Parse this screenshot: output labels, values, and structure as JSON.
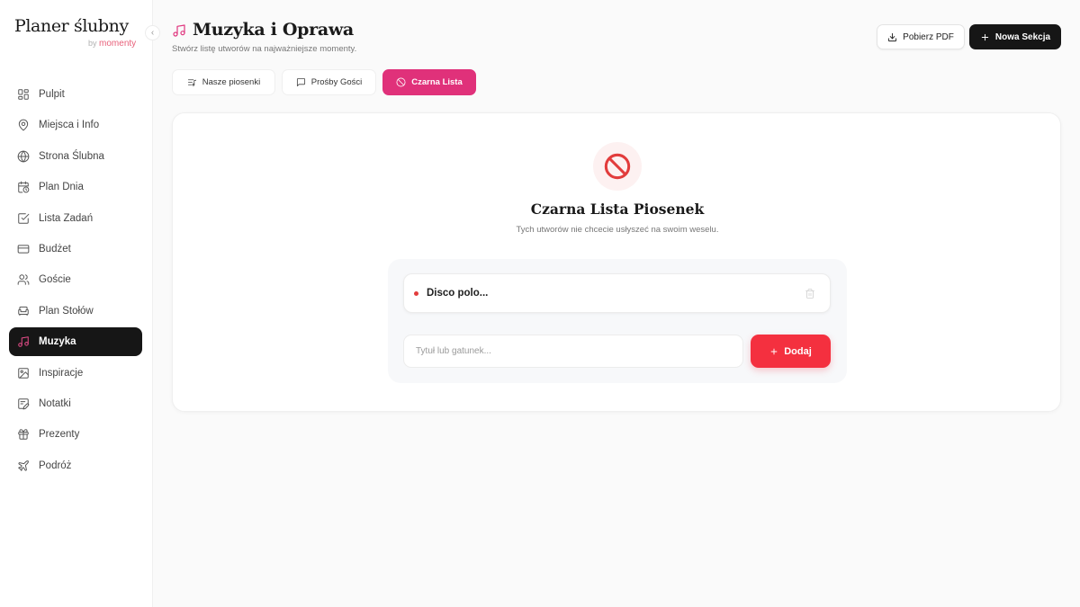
{
  "brand": {
    "title": "Planer ślubny",
    "sub_prefix": "by",
    "sub_name": "momenty"
  },
  "sidebar": {
    "collapse_glyph": "‹",
    "items": [
      {
        "label": "Pulpit",
        "icon": "grid-icon"
      },
      {
        "label": "Miejsca i Info",
        "icon": "map-pin-icon"
      },
      {
        "label": "Strona Ślubna",
        "icon": "globe-icon"
      },
      {
        "label": "Plan Dnia",
        "icon": "calendar-clock-icon"
      },
      {
        "label": "Lista Zadań",
        "icon": "check-square-icon"
      },
      {
        "label": "Budżet",
        "icon": "credit-card-icon"
      },
      {
        "label": "Goście",
        "icon": "users-icon"
      },
      {
        "label": "Plan Stołów",
        "icon": "armchair-icon"
      },
      {
        "label": "Muzyka",
        "icon": "music-icon",
        "active": true
      },
      {
        "label": "Inspiracje",
        "icon": "image-icon"
      },
      {
        "label": "Notatki",
        "icon": "note-icon"
      },
      {
        "label": "Prezenty",
        "icon": "gift-icon"
      },
      {
        "label": "Podróż",
        "icon": "plane-icon"
      }
    ]
  },
  "header": {
    "title": "Muzyka i Oprawa",
    "subtitle": "Stwórz listę utworów na najważniejsze momenty.",
    "pdf_button": "Pobierz PDF",
    "new_section_button": "Nowa Sekcja"
  },
  "tabs": [
    {
      "label": "Nasze piosenki",
      "icon": "list-music-icon"
    },
    {
      "label": "Prośby Gości",
      "icon": "message-icon"
    },
    {
      "label": "Czarna Lista",
      "icon": "ban-icon",
      "active": true
    }
  ],
  "blacklist": {
    "title": "Czarna Lista Piosenek",
    "subtitle": "Tych utworów nie chcecie usłyszeć na swoim weselu.",
    "items": [
      {
        "title": "Disco polo..."
      }
    ],
    "input_placeholder": "Tytuł lub gatunek...",
    "add_button": "Dodaj"
  },
  "colors": {
    "accent": "#e0317a",
    "danger": "#f4303f",
    "dark": "#161616"
  }
}
